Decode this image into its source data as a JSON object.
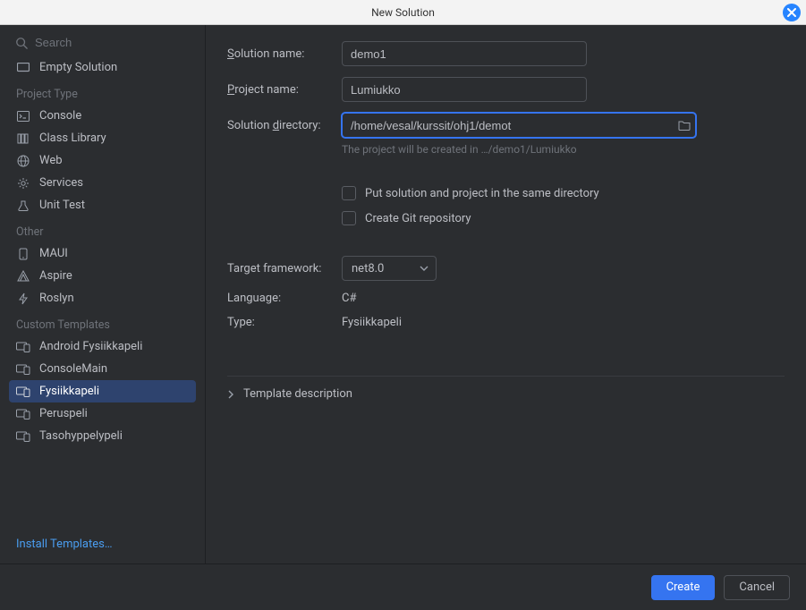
{
  "window": {
    "title": "New Solution"
  },
  "search": {
    "placeholder": "Search"
  },
  "sidebar": {
    "top": [
      {
        "label": "Empty Solution",
        "icon": "rectangle"
      }
    ],
    "sections": [
      {
        "title": "Project Type",
        "items": [
          {
            "label": "Console",
            "icon": "terminal"
          },
          {
            "label": "Class Library",
            "icon": "books"
          },
          {
            "label": "Web",
            "icon": "globe"
          },
          {
            "label": "Services",
            "icon": "gear"
          },
          {
            "label": "Unit Test",
            "icon": "test"
          }
        ]
      },
      {
        "title": "Other",
        "items": [
          {
            "label": "MAUI",
            "icon": "phone"
          },
          {
            "label": "Aspire",
            "icon": "aspire"
          },
          {
            "label": "Roslyn",
            "icon": "bolt"
          }
        ]
      },
      {
        "title": "Custom Templates",
        "items": [
          {
            "label": "Android Fysiikkapeli",
            "icon": "device"
          },
          {
            "label": "ConsoleMain",
            "icon": "device"
          },
          {
            "label": "Fysiikkapeli",
            "icon": "device",
            "selected": true
          },
          {
            "label": "Peruspeli",
            "icon": "device"
          },
          {
            "label": "Tasohyppelypeli",
            "icon": "device"
          }
        ]
      }
    ],
    "install_link": "Install Templates…"
  },
  "form": {
    "solution_name": {
      "label": "Solution name:",
      "value": "demo1"
    },
    "project_name": {
      "label": "Project name:",
      "value": "Lumiukko"
    },
    "solution_directory": {
      "label": "Solution directory:",
      "value": "/home/vesal/kurssit/ohj1/demot"
    },
    "help": "The project will be created in …/demo1/Lumiukko",
    "same_dir": {
      "label": "Put solution and project in the same directory"
    },
    "git": {
      "label": "Create Git repository"
    },
    "target_framework": {
      "label": "Target framework:",
      "value": "net8.0"
    },
    "language": {
      "label": "Language:",
      "value": "C#"
    },
    "type": {
      "label": "Type:",
      "value": "Fysiikkapeli"
    },
    "template_desc": "Template description"
  },
  "buttons": {
    "create": "Create",
    "cancel": "Cancel"
  }
}
